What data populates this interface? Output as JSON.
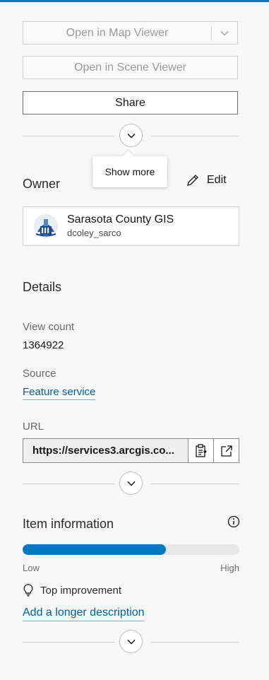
{
  "actions": {
    "open_map_viewer": "Open in Map Viewer",
    "open_scene_viewer": "Open in Scene Viewer",
    "share": "Share"
  },
  "show_more_tooltip": "Show more",
  "owner": {
    "heading": "Owner",
    "edit_label": "Edit",
    "name": "Sarasota County GIS",
    "username": "dcoley_sarco"
  },
  "details": {
    "heading": "Details",
    "view_count_label": "View count",
    "view_count": "1364922",
    "source_label": "Source",
    "source_value": "Feature service",
    "url_label": "URL",
    "url_value": "https://services3.arcgis.co..."
  },
  "item_information": {
    "heading": "Item information",
    "score_fraction": 0.66,
    "low_label": "Low",
    "high_label": "High",
    "tip_label": "Top improvement",
    "tip_link": "Add a longer description"
  },
  "colors": {
    "accent": "#0079c1",
    "link": "#00619b"
  }
}
